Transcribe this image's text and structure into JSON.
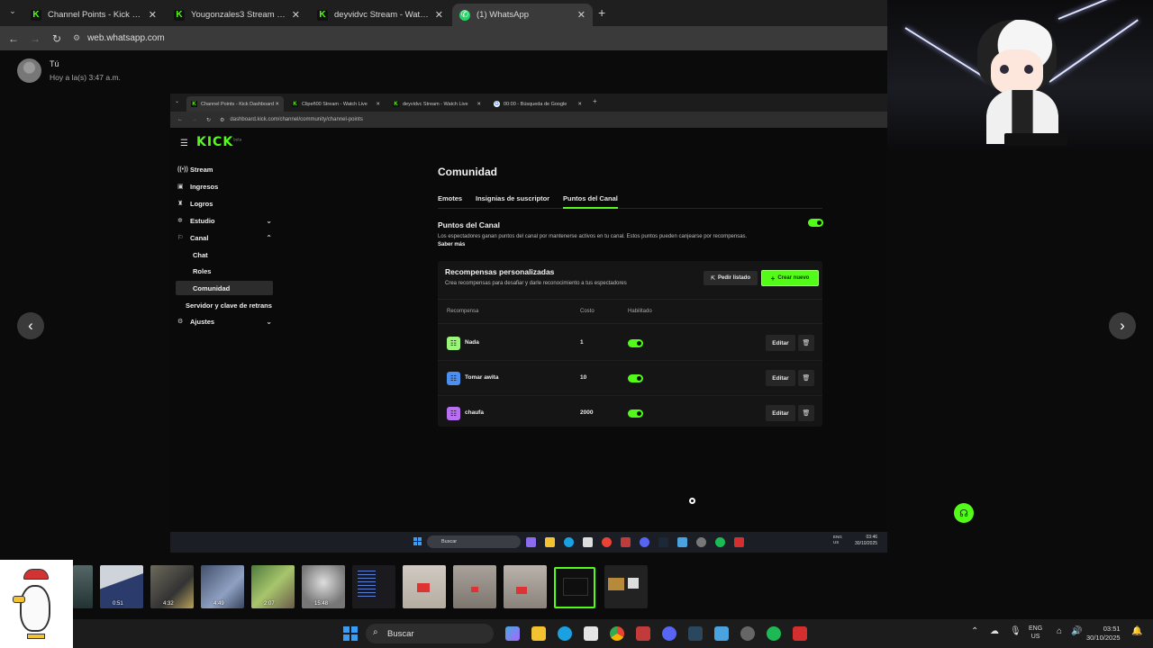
{
  "browser": {
    "tabs": [
      {
        "label": "Channel Points - Kick Dashboard",
        "icon": "kick-icon"
      },
      {
        "label": "Yougonzales3 Stream - Watch Live on Kick",
        "icon": "kick-icon"
      },
      {
        "label": "deyvidvc Stream - Watch Live on Kick",
        "icon": "kick-icon"
      },
      {
        "label": "(1) WhatsApp",
        "icon": "whatsapp-icon",
        "active": true
      }
    ],
    "url": "web.whatsapp.com"
  },
  "whatsapp": {
    "sender": "Tú",
    "time": "Hoy a la(s) 3:47 a.m."
  },
  "inner_browser": {
    "tabs": [
      {
        "label": "Channel Points - Kick Dashboard",
        "active": true
      },
      {
        "label": "Clipeñ00 Stream - Watch Live",
        "active": false
      },
      {
        "label": "deyvidvc Stream - Watch Live",
        "active": false
      },
      {
        "label": "00:00 - Búsqueda de Google",
        "active": false
      }
    ],
    "url": "dashboard.kick.com/channel/community/channel-points"
  },
  "kick": {
    "logo": "KICK",
    "logo_badge": "beta",
    "nav": [
      {
        "label": "Stream",
        "icon": "broadcast-icon"
      },
      {
        "label": "Ingresos",
        "icon": "wallet-icon"
      },
      {
        "label": "Logros",
        "icon": "trophy-icon"
      },
      {
        "label": "Estudio",
        "icon": "studio-icon",
        "chevron": "down"
      },
      {
        "label": "Canal",
        "icon": "channel-icon",
        "chevron": "up"
      }
    ],
    "sub_nav": [
      "Chat",
      "Roles",
      "Comunidad"
    ],
    "nav_bottom": [
      {
        "label": "Servidor y clave de retrans"
      },
      {
        "label": "Ajustes",
        "icon": "gear-icon",
        "chevron": "down"
      }
    ],
    "page_title": "Comunidad",
    "tabs": [
      "Emotes",
      "Insignias de suscriptor",
      "Puntos del Canal"
    ],
    "active_tab": "Puntos del Canal",
    "channel_points": {
      "title": "Puntos del Canal",
      "description": "Los espectadores ganan puntos del canal por mantenerse activos en tu canal. Estos puntos pueden canjearse por recompensas.",
      "learn_more": "Saber más",
      "enabled": true
    },
    "rewards_card": {
      "title": "Recompensas personalizadas",
      "subtitle": "Crea recompensas para desafiar y darle reconocimiento a tus espectadores",
      "request_list": "Pedir listado",
      "create_new": "Crear nuevo",
      "columns": [
        "Recompensa",
        "Costo",
        "Habilitado"
      ],
      "rows": [
        {
          "name": "Nada",
          "cost": "1",
          "enabled": true,
          "color": "#9cf57a"
        },
        {
          "name": "Tomar awita",
          "cost": "10",
          "enabled": true,
          "color": "#4b8ff0"
        },
        {
          "name": "chaufa",
          "cost": "2000",
          "enabled": true,
          "color": "#b86ff2"
        }
      ],
      "edit_label": "Editar"
    }
  },
  "inner_taskbar": {
    "search": "Buscar",
    "lang": "ENG\nUS",
    "time": "03:46",
    "date": "30/10/2025"
  },
  "taskbar": {
    "search": "Buscar",
    "lang_line1": "ENG",
    "lang_line2": "US",
    "time": "03:51",
    "date": "30/10/2025"
  },
  "thumbnails": [
    {
      "duration": ""
    },
    {
      "duration": "0:51"
    },
    {
      "duration": "4:32"
    },
    {
      "duration": "4:49"
    },
    {
      "duration": "2:07"
    },
    {
      "duration": "15:48"
    },
    {
      "duration": ""
    },
    {
      "duration": ""
    },
    {
      "duration": ""
    },
    {
      "duration": ""
    },
    {
      "duration": ""
    },
    {
      "duration": ""
    }
  ],
  "colors": {
    "kick_green": "#53fc18",
    "whatsapp_green": "#25d366",
    "windows_blue": "#3a9cf5"
  }
}
